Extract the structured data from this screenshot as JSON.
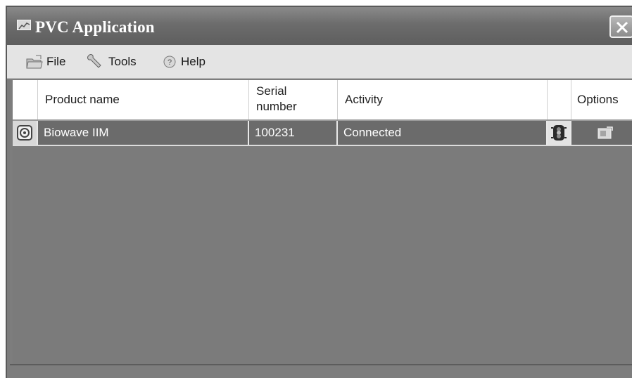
{
  "window": {
    "title": "PVC Application",
    "icons": {
      "app": "app-chart-icon",
      "close": "close-icon"
    }
  },
  "menu": {
    "items": [
      {
        "label": "File",
        "icon": "folder-icon"
      },
      {
        "label": "Tools",
        "icon": "wrench-icon"
      },
      {
        "label": "Help",
        "icon": "help-icon"
      }
    ]
  },
  "grid": {
    "columns": {
      "product_name": "Product name",
      "serial_line1": "Serial",
      "serial_line2": "number",
      "activity": "Activity",
      "status": "",
      "options": "Options"
    },
    "rows": [
      {
        "product_name": "Biowave IIM",
        "serial_number": "100231",
        "activity": "Connected",
        "status_icon": "traffic-light-icon",
        "options_icon": "options-icon",
        "row_icon": "device-icon"
      }
    ]
  }
}
